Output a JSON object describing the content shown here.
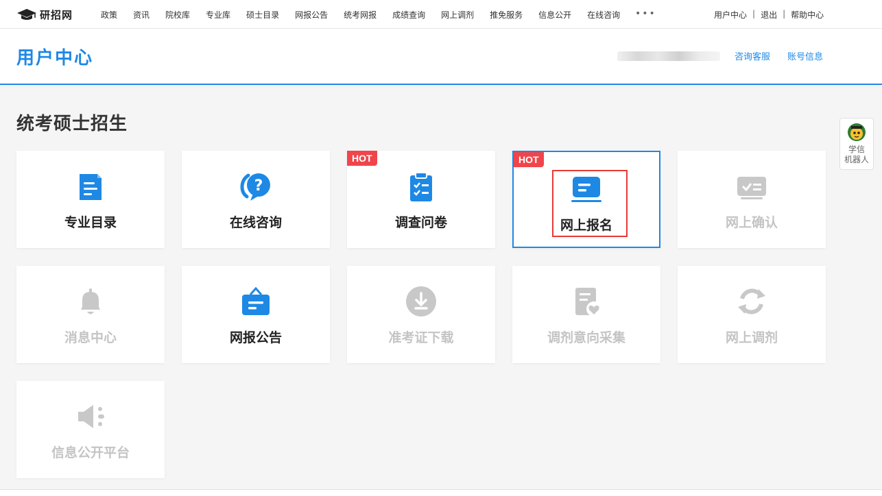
{
  "site": {
    "logo_text": "研招网"
  },
  "nav": {
    "links": [
      "政策",
      "资讯",
      "院校库",
      "专业库",
      "硕士目录",
      "网报公告",
      "统考网报",
      "成绩查询",
      "网上调剂",
      "推免服务",
      "信息公开",
      "在线咨询"
    ],
    "more": "•••"
  },
  "user_links": {
    "user_center": "用户中心",
    "sep": "|",
    "logout": "退出",
    "help": "帮助中心"
  },
  "header": {
    "title": "用户中心",
    "consult": "咨询客服",
    "account": "账号信息"
  },
  "section": {
    "title": "统考硕士招生"
  },
  "cards": [
    {
      "label": "专业目录",
      "icon": "catalog-icon",
      "enabled": true,
      "hot": false
    },
    {
      "label": "在线咨询",
      "icon": "question-chat-icon",
      "enabled": true,
      "hot": false
    },
    {
      "label": "调查问卷",
      "icon": "clipboard-check-icon",
      "enabled": true,
      "hot": true
    },
    {
      "label": "网上报名",
      "icon": "register-form-icon",
      "enabled": true,
      "hot": true,
      "selected": true
    },
    {
      "label": "网上确认",
      "icon": "confirm-icon",
      "enabled": false,
      "hot": false
    },
    {
      "label": "消息中心",
      "icon": "bell-icon",
      "enabled": false,
      "hot": false
    },
    {
      "label": "网报公告",
      "icon": "notice-bag-icon",
      "enabled": true,
      "hot": false
    },
    {
      "label": "准考证下载",
      "icon": "download-icon",
      "enabled": false,
      "hot": false
    },
    {
      "label": "调剂意向采集",
      "icon": "intent-form-icon",
      "enabled": false,
      "hot": false
    },
    {
      "label": "网上调剂",
      "icon": "refresh-icon",
      "enabled": false,
      "hot": false
    },
    {
      "label": "信息公开平台",
      "icon": "speaker-icon",
      "enabled": false,
      "hot": false
    }
  ],
  "hot_badge": "HOT",
  "robot": {
    "line1": "学信",
    "line2": "机器人"
  },
  "colors": {
    "accent": "#1e88e5",
    "hot": "#f0454b",
    "disabled": "#c4c4c4",
    "highlight_box": "#e53935"
  }
}
